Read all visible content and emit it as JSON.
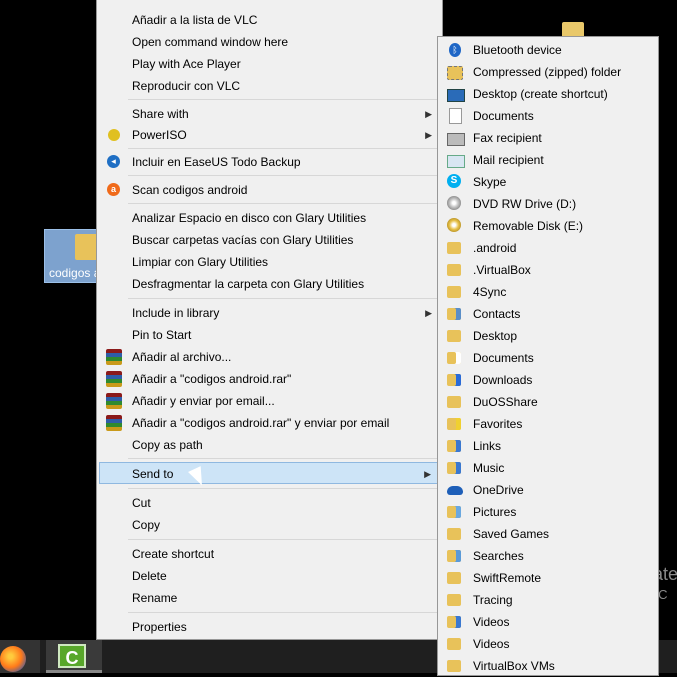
{
  "desktop": {
    "icon_label": "codigos a",
    "activation": {
      "title": "Activate",
      "subtitle": "Go to PC"
    }
  },
  "context_menu": {
    "items": [
      {
        "label": "Añadir a la lista de VLC"
      },
      {
        "label": "Open command window here"
      },
      {
        "label": "Play with Ace Player"
      },
      {
        "label": "Reproducir con VLC"
      },
      {
        "label": "Share with",
        "submenu": true
      },
      {
        "label": "PowerISO",
        "submenu": true,
        "icon": "poweriso-icon"
      },
      {
        "label": "Incluir en EaseUS Todo Backup",
        "icon": "easeus-icon"
      },
      {
        "label": "Scan codigos android",
        "icon": "avast-icon"
      },
      {
        "label": "Analizar Espacio en disco con Glary Utilities"
      },
      {
        "label": "Buscar carpetas vacías con Glary Utilities"
      },
      {
        "label": "Limpiar con Glary Utilities"
      },
      {
        "label": "Desfragmentar la carpeta con Glary Utilities"
      },
      {
        "label": "Include in library",
        "submenu": true
      },
      {
        "label": "Pin to Start"
      },
      {
        "label": "Añadir al archivo...",
        "icon": "winrar-icon"
      },
      {
        "label": "Añadir a \"codigos android.rar\"",
        "icon": "winrar-icon"
      },
      {
        "label": "Añadir y enviar por email...",
        "icon": "winrar-icon"
      },
      {
        "label": "Añadir a \"codigos android.rar\" y enviar por email",
        "icon": "winrar-icon"
      },
      {
        "label": "Copy as path"
      },
      {
        "label": "Send to",
        "submenu": true,
        "highlighted": true
      },
      {
        "label": "Cut"
      },
      {
        "label": "Copy"
      },
      {
        "label": "Create shortcut"
      },
      {
        "label": "Delete"
      },
      {
        "label": "Rename"
      },
      {
        "label": "Properties"
      }
    ]
  },
  "send_to_menu": {
    "items": [
      {
        "label": "Bluetooth device",
        "icon": "bluetooth-icon"
      },
      {
        "label": "Compressed (zipped) folder",
        "icon": "zip-folder-icon"
      },
      {
        "label": "Desktop (create shortcut)",
        "icon": "desktop-icon"
      },
      {
        "label": "Documents",
        "icon": "document-icon"
      },
      {
        "label": "Fax recipient",
        "icon": "fax-icon"
      },
      {
        "label": "Mail recipient",
        "icon": "mail-icon"
      },
      {
        "label": "Skype",
        "icon": "skype-icon"
      },
      {
        "label": "DVD RW Drive (D:)",
        "icon": "dvd-drive-icon"
      },
      {
        "label": "Removable Disk (E:)",
        "icon": "removable-disk-icon"
      },
      {
        "label": ".android",
        "icon": "folder-icon"
      },
      {
        "label": ".VirtualBox",
        "icon": "folder-icon"
      },
      {
        "label": "4Sync",
        "icon": "folder-icon"
      },
      {
        "label": "Contacts",
        "icon": "contacts-folder-icon"
      },
      {
        "label": "Desktop",
        "icon": "folder-icon"
      },
      {
        "label": "Documents",
        "icon": "documents-folder-icon"
      },
      {
        "label": "Downloads",
        "icon": "downloads-folder-icon"
      },
      {
        "label": "DuOSShare",
        "icon": "folder-icon"
      },
      {
        "label": "Favorites",
        "icon": "favorites-folder-icon"
      },
      {
        "label": "Links",
        "icon": "links-folder-icon"
      },
      {
        "label": "Music",
        "icon": "music-folder-icon"
      },
      {
        "label": "OneDrive",
        "icon": "onedrive-icon"
      },
      {
        "label": "Pictures",
        "icon": "pictures-folder-icon"
      },
      {
        "label": "Saved Games",
        "icon": "folder-icon"
      },
      {
        "label": "Searches",
        "icon": "searches-folder-icon"
      },
      {
        "label": "SwiftRemote",
        "icon": "folder-icon"
      },
      {
        "label": "Tracing",
        "icon": "folder-icon"
      },
      {
        "label": "Videos",
        "icon": "videos-folder-icon"
      },
      {
        "label": "Videos",
        "icon": "folder-icon"
      },
      {
        "label": "VirtualBox VMs",
        "icon": "folder-icon"
      }
    ]
  },
  "taskbar": {
    "apps": [
      {
        "name": "firefox-icon"
      },
      {
        "name": "camtasia-icon",
        "glyph": "C"
      }
    ]
  },
  "colors": {
    "menu_background": "#f0f0f0",
    "menu_border": "#979797",
    "highlight": "#cde4f7",
    "highlight_border": "#8fb8e0",
    "folder": "#e8c25a"
  }
}
